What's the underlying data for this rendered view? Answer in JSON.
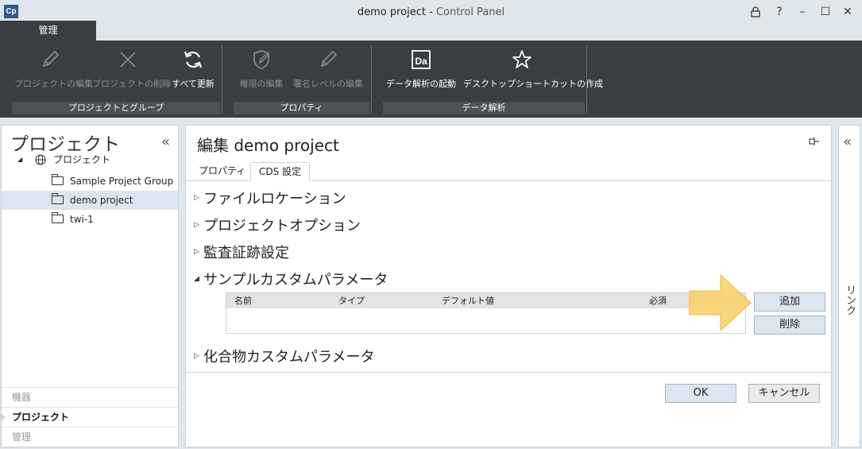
{
  "window": {
    "logo": "Cp",
    "title_main": "demo project - ",
    "title_sub": "Control Panel",
    "controls": {
      "lock": "🔒",
      "help": "?",
      "minimize": "–",
      "maximize": "☐",
      "close": "✕"
    }
  },
  "ribbon": {
    "tab": "管理",
    "buttons": {
      "edit_project": "プロジェクトの編集",
      "delete_project": "プロジェクトの削除",
      "refresh_all": "すべて更新",
      "edit_permissions": "権限の編集",
      "edit_signature": "署名レベルの編集",
      "launch_analysis": "データ解析の起動",
      "create_shortcut": "デスクトップショートカットの作成"
    },
    "groups": {
      "project_group": "プロジェクトとグループ",
      "properties": "プロパティ",
      "data_analysis": "データ解析"
    }
  },
  "left_panel": {
    "title": "プロジェクト",
    "collapse": "«",
    "tree": {
      "root": "プロジェクト",
      "items": [
        "Sample Project Group",
        "demo project",
        "twi-1"
      ]
    },
    "nav": [
      "機器",
      "プロジェクト",
      "管理"
    ]
  },
  "main": {
    "title": "編集 demo project",
    "tabs": [
      "プロパティ",
      "CDS 設定"
    ],
    "sections": {
      "file_location": "ファイルロケーション",
      "project_options": "プロジェクトオプション",
      "audit_trail": "監査証跡設定",
      "sample_params": "サンプルカスタムパラメータ",
      "compound_params": "化合物カスタムパラメータ"
    },
    "arrows": {
      "collapsed": "▷",
      "expanded": "◢"
    },
    "table": {
      "headers": [
        "名前",
        "タイプ",
        "デフォルト値",
        "必須"
      ]
    },
    "buttons": {
      "add": "追加",
      "delete": "削除",
      "ok": "OK",
      "cancel": "キャンセル"
    }
  },
  "right_bar": {
    "collapse": "«",
    "label": "リンク"
  },
  "colors": {
    "ribbon_bg": "#393e43",
    "selected_row": "#dce6f1",
    "callout_arrow": "#f9d26b"
  }
}
